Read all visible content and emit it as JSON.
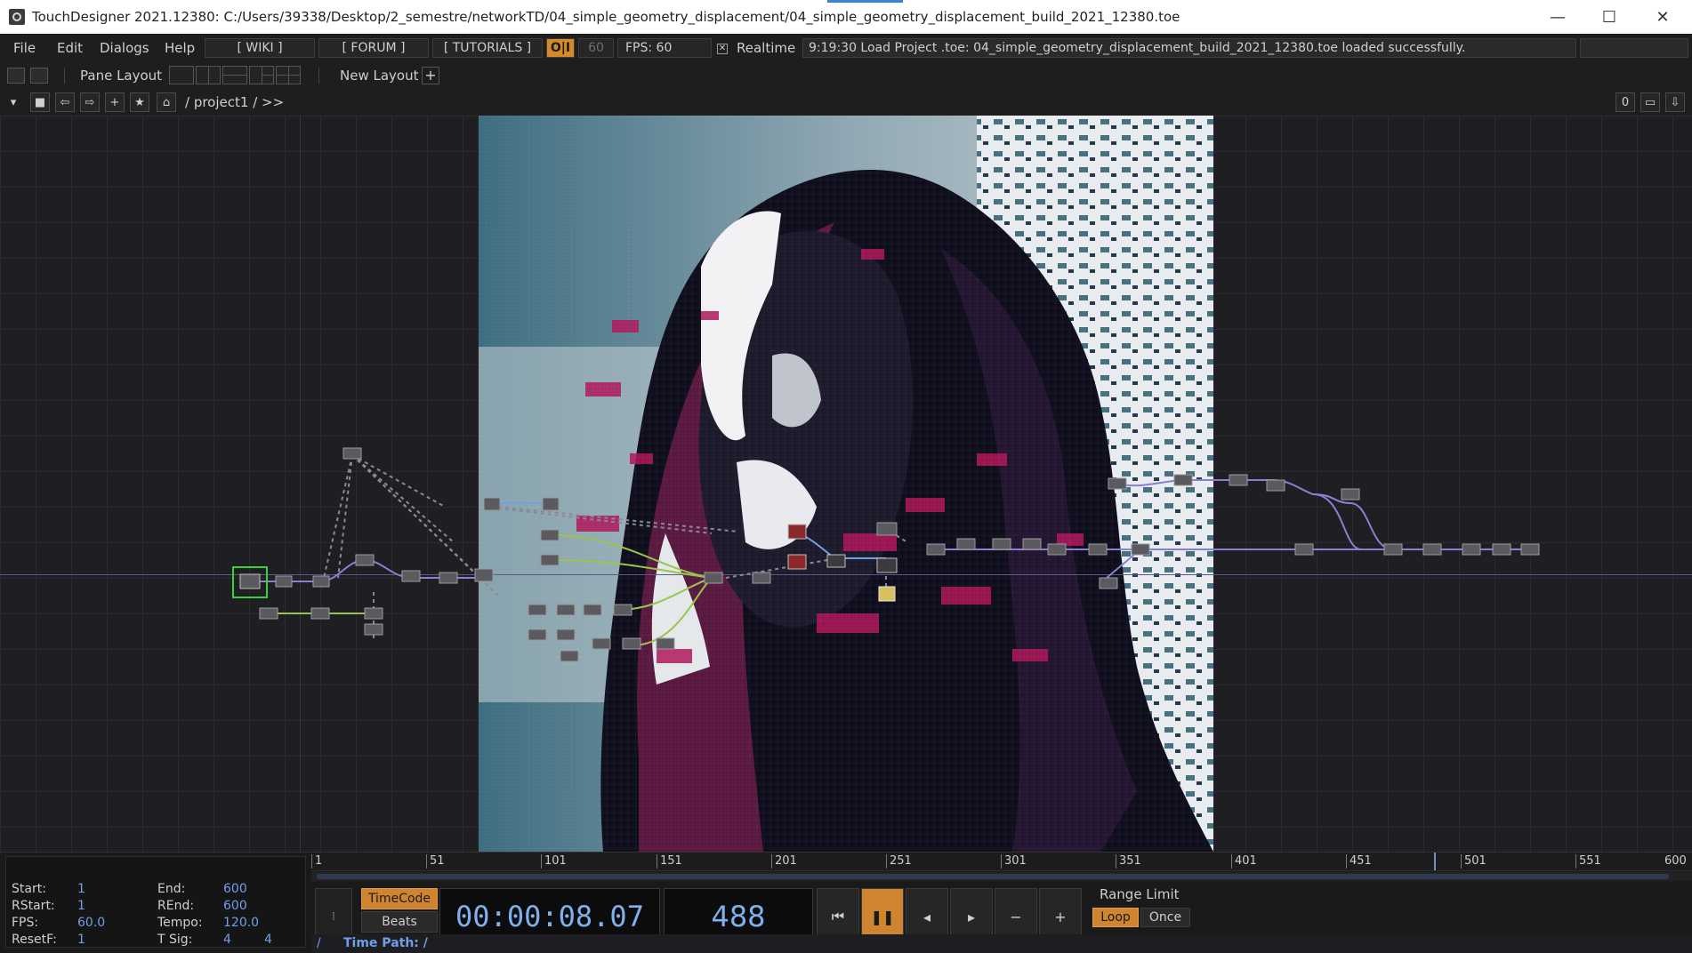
{
  "window": {
    "title": "TouchDesigner 2021.12380: C:/Users/39338/Desktop/2_semestre/networkTD/04_simple_geometry_displacement/04_simple_geometry_displacement_build_2021_12380.toe",
    "controls": [
      "—",
      "☐",
      "✕"
    ]
  },
  "menubar": {
    "items": [
      "File",
      "Edit",
      "Dialogs",
      "Help"
    ],
    "wiki": "[ WIKI ]",
    "forum": "[ FORUM ]",
    "tutorials": "[ TUTORIALS ]",
    "oi": "O|I",
    "sixty": "60",
    "fps": "FPS:  60",
    "realtime": "Realtime",
    "status": "9:19:30 Load Project .toe: 04_simple_geometry_displacement_build_2021_12380.toe loaded successfully."
  },
  "layoutbar": {
    "pane_layout": "Pane Layout",
    "new_layout": "New Layout",
    "plus": "+"
  },
  "pathbar": {
    "path": "/ project1 / >>",
    "right_value": "0"
  },
  "timeline": {
    "info": {
      "start_label": "Start:",
      "start": "1",
      "end_label": "End:",
      "end": "600",
      "rstart_label": "RStart:",
      "rstart": "1",
      "rend_label": "REnd:",
      "rend": "600",
      "fps_label": "FPS:",
      "fps": "60.0",
      "tempo_label": "Tempo:",
      "tempo": "120.0",
      "resetf_label": "ResetF:",
      "resetf": "1",
      "tsig_label": "T Sig:",
      "tsig_a": "4",
      "tsig_b": "4"
    },
    "ruler_ticks": [
      "1",
      "51",
      "101",
      "151",
      "201",
      "251",
      "301",
      "351",
      "401",
      "451",
      "501",
      "551",
      "600"
    ],
    "timecode_label": "TimeCode",
    "beats_label": "Beats",
    "timecode": "00:00:08.07",
    "frame": "488",
    "range_limit": "Range Limit",
    "loop": "Loop",
    "once": "Once",
    "time_path_label": "Time Path: /",
    "slash": "/"
  },
  "colors": {
    "accent_orange": "#cf8530",
    "accent_blue": "#6fa0e8",
    "wire_purple": "#8a7fd0",
    "wire_green": "#9ac54a"
  }
}
